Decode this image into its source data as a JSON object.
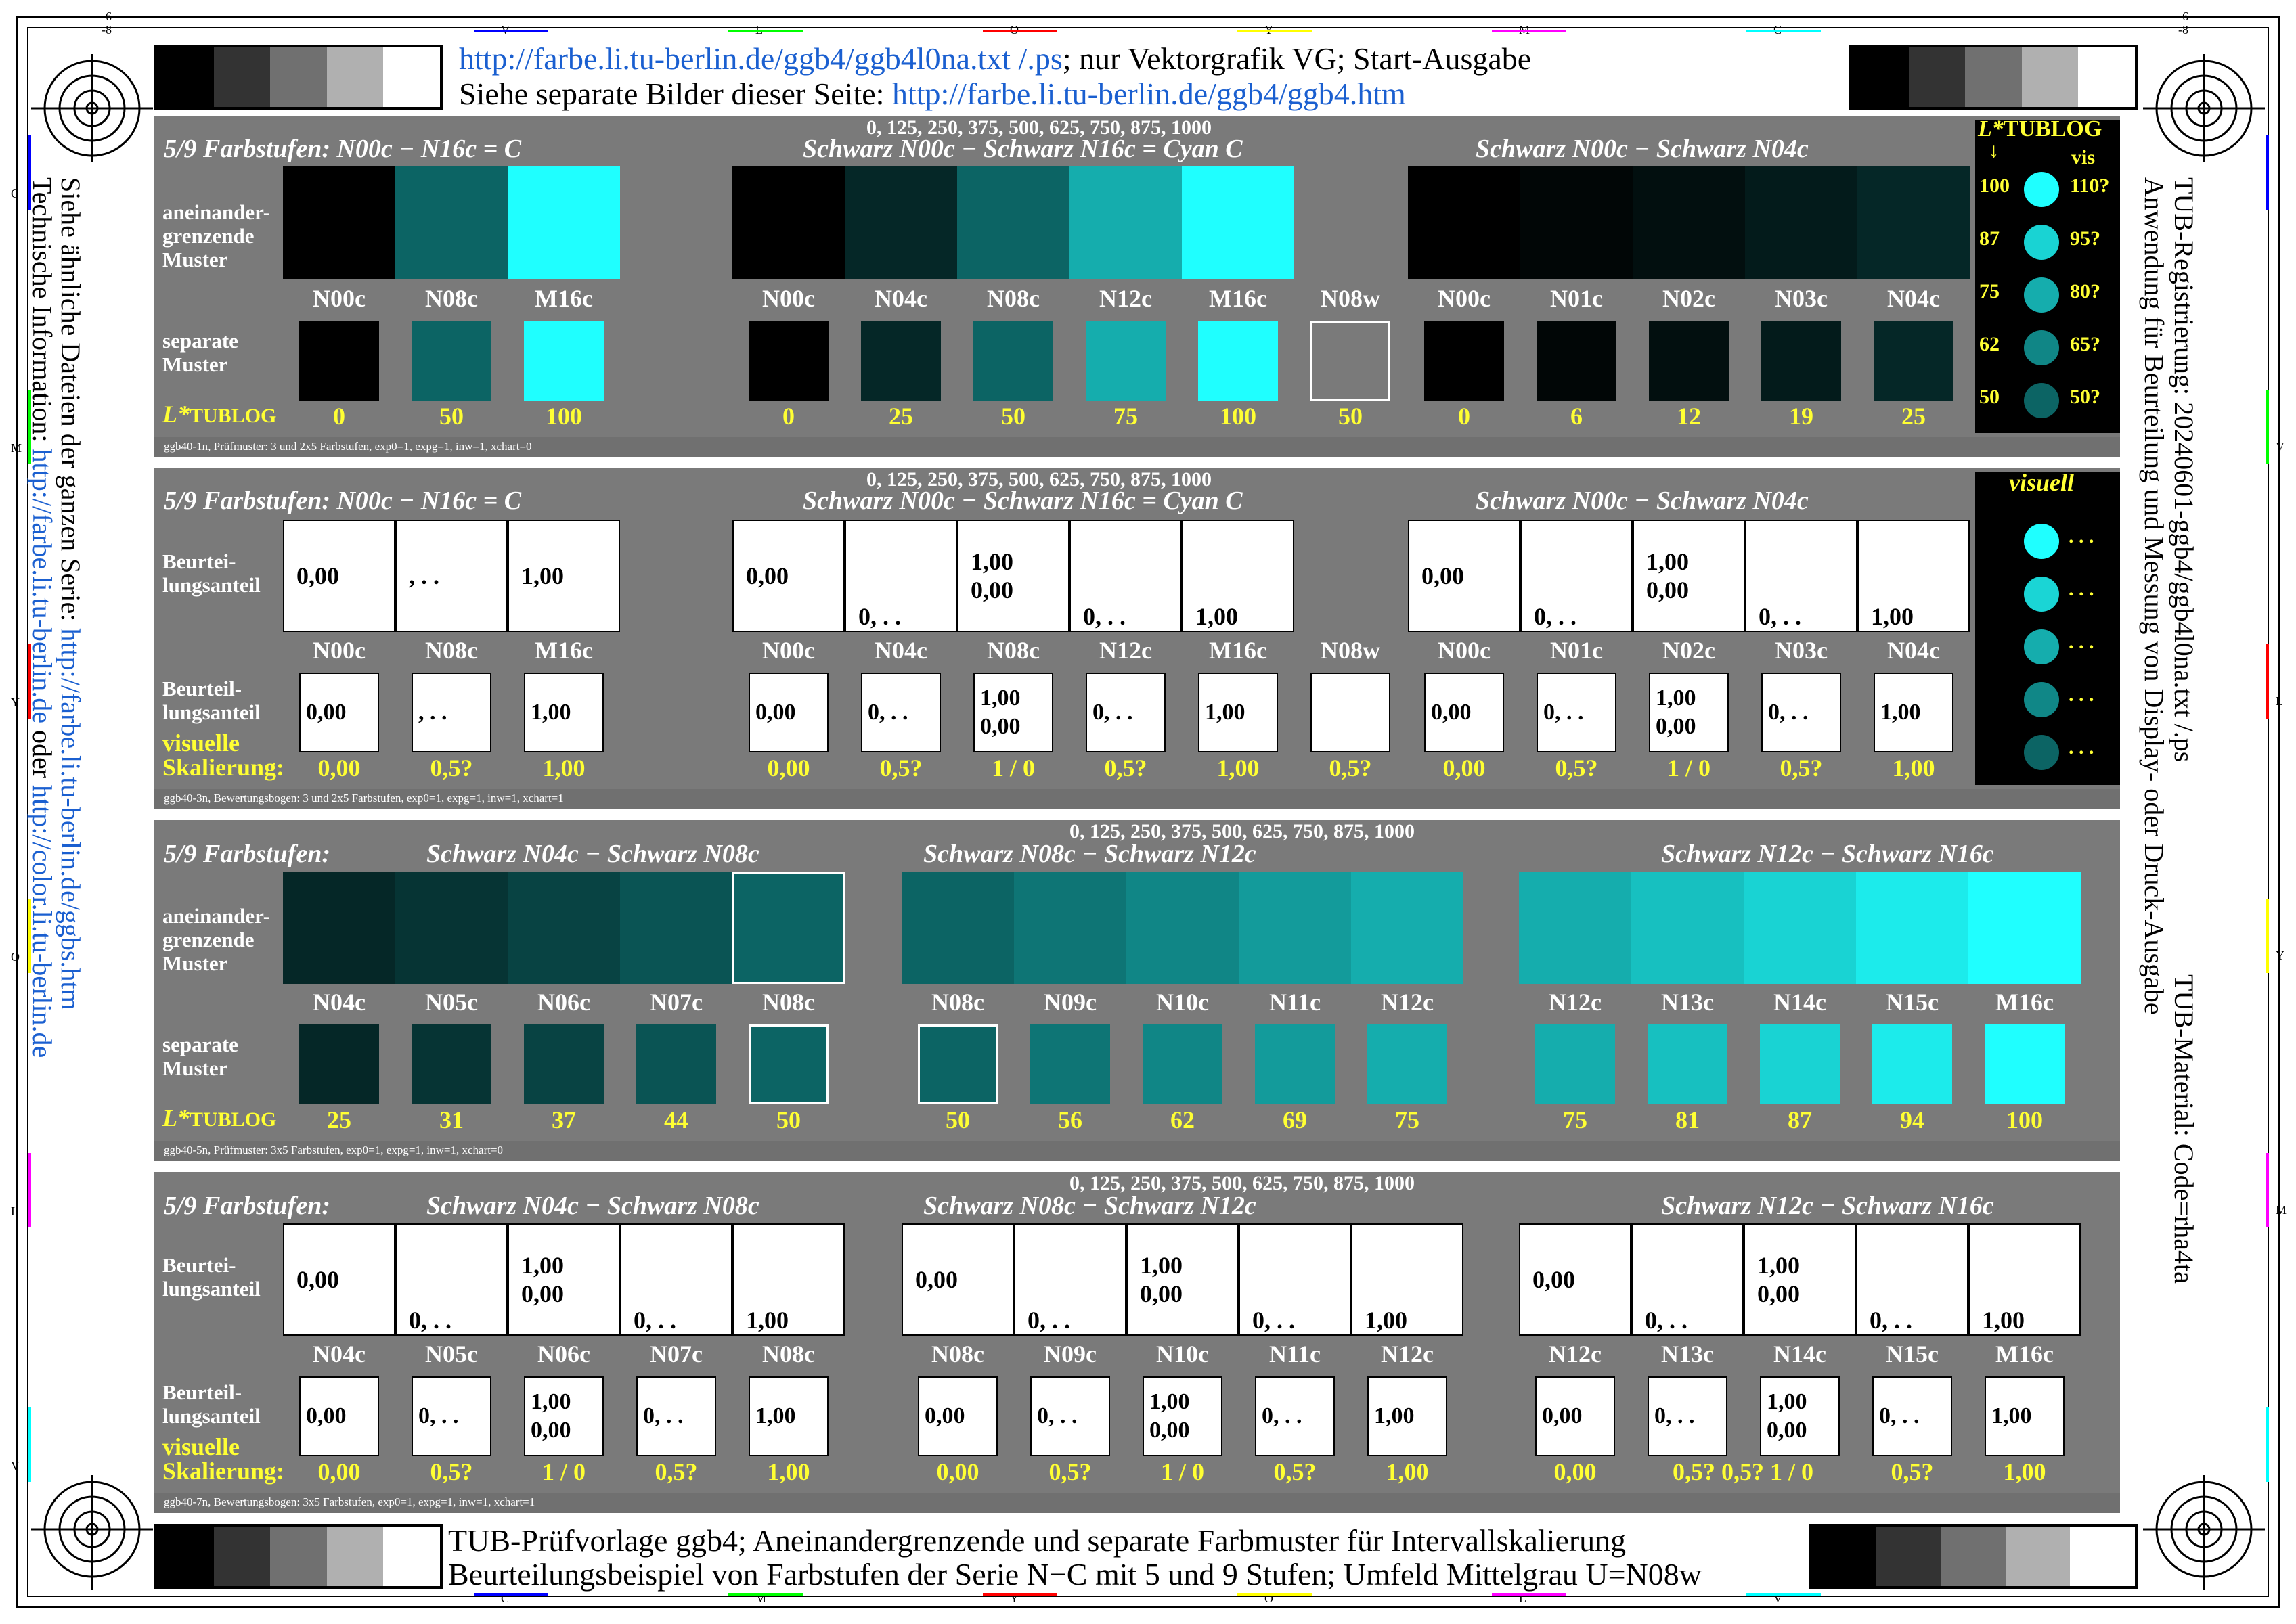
{
  "header": {
    "line1_link": "http://farbe.li.tu-berlin.de/ggb4/ggb4l0na.txt /.ps",
    "line1_rest": "; nur Vektorgrafik VG; Start-Ausgabe",
    "line2_pre": "Siehe separate Bilder dieser Seite: ",
    "line2_link": "http://farbe.li.tu-berlin.de/ggb4/ggb4.htm"
  },
  "footer": {
    "line1": "TUB-Prüfvorlage ggb4; Aneinandergrenzende und separate Farbmuster für Intervallskalierung",
    "line2": "Beurteilungsbeispiel von Farbstufen der Serie N−C mit 5 und 9 Stufen; Umfeld Mittelgrau U=N08w"
  },
  "left_side": {
    "line1_pre": "Siehe ähnliche Dateien der ganzen Serie: ",
    "line1_link": "http://farbe.li.tu-berlin.de/ggbs.htm",
    "line2_pre": "Technische Information: ",
    "line2_link1": "http://farbe.li.tu-berlin.de",
    "line2_mid": " oder ",
    "line2_link2": "http://color.li.tu-berlin.de"
  },
  "right_side": {
    "line1": "TUB-Registrierung: 20240601-ggb4/ggb4l0na.txt /.ps",
    "line2": "Anwendung für Beurteilung und Messung von Display- oder Druck-Ausgabe",
    "line3": "TUB-Material: Code=rha4ta"
  },
  "edge_marks": {
    "top": [
      "V",
      "L",
      "O",
      "Y",
      "M",
      "C"
    ],
    "bottom": [
      "C",
      "M",
      "Y",
      "O",
      "L",
      "V"
    ],
    "left": [
      "C",
      "M",
      "Y",
      "O",
      "L",
      "V"
    ],
    "right": [
      "V",
      "L",
      "Y",
      "M"
    ],
    "corner_top_left": "-6",
    "corner_top_left_b": "-8",
    "corner_top_right": "-6",
    "corner_top_right_b": "-8"
  },
  "common": {
    "steps_top": "0, 125, 250, 375, 500, 625, 750, 875, 1000",
    "lstar_label": "L*",
    "lstar_sub": "TUBLOG",
    "adjacent_label": [
      "aneinander-",
      "grenzende",
      "Muster"
    ],
    "separate_label": [
      "separate",
      "Muster"
    ],
    "judge_label": [
      "Beurtei-",
      "lungsanteil"
    ],
    "judge2_label": [
      "Beurteil-",
      "lungsanteil"
    ],
    "visual_label": "visuelle",
    "scaling_label": "Skalierung:"
  },
  "panel1": {
    "title_left": "5/9 Farbstufen:  N00c − N16c = C",
    "title_mid": "Schwarz N00c − Schwarz N16c = Cyan C",
    "title_right": "Schwarz N00c − Schwarz N04c",
    "caption": "ggb40-1n, Prüfmuster: 3 und 2x5 Farbstufen, exp0=1, expg=1, inw=1, xchart=0",
    "codes": [
      "N00c",
      "N08c",
      "M16c",
      "N00c",
      "N04c",
      "N08c",
      "N12c",
      "M16c",
      "N08w",
      "N00c",
      "N01c",
      "N02c",
      "N03c",
      "N04c"
    ],
    "values": [
      "0",
      "50",
      "100",
      "0",
      "25",
      "50",
      "75",
      "100",
      "50",
      "0",
      "6",
      "12",
      "19",
      "25"
    ]
  },
  "panel1_side": {
    "title": "L*TUBLOG",
    "sub": "vis",
    "arrow": "↓",
    "left": [
      "100",
      "87",
      "75",
      "62",
      "50"
    ],
    "right": [
      "110?",
      "95?",
      "80?",
      "65?",
      "50?"
    ]
  },
  "panel2": {
    "title_left": "5/9 Farbstufen:  N00c − N16c = C",
    "title_mid": "Schwarz N00c − Schwarz N16c = Cyan C",
    "title_right": "Schwarz N00c − Schwarz N04c",
    "caption": "ggb40-3n, Bewertungsbogen: 3 und 2x5 Farbstufen, exp0=1, expg=1, inw=1, xchart=1",
    "codes": [
      "N00c",
      "N08c",
      "M16c",
      "N00c",
      "N04c",
      "N08c",
      "N12c",
      "M16c",
      "N08w",
      "N00c",
      "N01c",
      "N02c",
      "N03c",
      "N04c"
    ],
    "scale": [
      "0,00",
      "0,5?",
      "1,00",
      "0,00",
      "0,5?",
      "1 / 0",
      "0,5?",
      "1,00",
      "0,5?",
      "0,00",
      "0,5?",
      "1 / 0",
      "0,5?",
      "1,00"
    ],
    "side_title": "visuell",
    "side_dots": ". . ."
  },
  "panel3": {
    "title_left": "5/9 Farbstufen:",
    "title_a": "Schwarz N04c − Schwarz N08c",
    "title_b": "Schwarz N08c − Schwarz N12c",
    "title_c": "Schwarz N12c − Schwarz N16c",
    "caption": "ggb40-5n, Prüfmuster: 3x5 Farbstufen, exp0=1, expg=1, inw=1, xchart=0",
    "codes": [
      "N04c",
      "N05c",
      "N06c",
      "N07c",
      "N08c",
      "N08c",
      "N09c",
      "N10c",
      "N11c",
      "N12c",
      "N12c",
      "N13c",
      "N14c",
      "N15c",
      "M16c"
    ],
    "values": [
      "25",
      "31",
      "37",
      "44",
      "50",
      "50",
      "56",
      "62",
      "69",
      "75",
      "75",
      "81",
      "87",
      "94",
      "100"
    ]
  },
  "panel4": {
    "title_left": "5/9 Farbstufen:",
    "title_a": "Schwarz N04c − Schwarz N08c",
    "title_b": "Schwarz N08c − Schwarz N12c",
    "title_c": "Schwarz N12c − Schwarz N16c",
    "caption": "ggb40-7n, Bewertungsbogen: 3x5 Farbstufen, exp0=1, expg=1, inw=1, xchart=1",
    "codes": [
      "N04c",
      "N05c",
      "N06c",
      "N07c",
      "N08c",
      "N08c",
      "N09c",
      "N10c",
      "N11c",
      "N12c",
      "N12c",
      "N13c",
      "N14c",
      "N15c",
      "M16c"
    ],
    "scale": [
      "0,00",
      "0,5?",
      "1 / 0",
      "0,5?",
      "1,00",
      "0,00",
      "0,5?",
      "1 / 0",
      "0,5?",
      "1,00",
      "0,00",
      "0,5? 0,5? 1 / 0",
      "",
      "0,5?",
      "1,00"
    ]
  },
  "box_text": {
    "zero": "0,00",
    "partial": "0, . .",
    "dots": ", . .",
    "one": "1,00"
  },
  "colors": {
    "panel_bg": "#7a7a7a",
    "yellow": "#ffff33",
    "link": "#1a5fd0"
  }
}
